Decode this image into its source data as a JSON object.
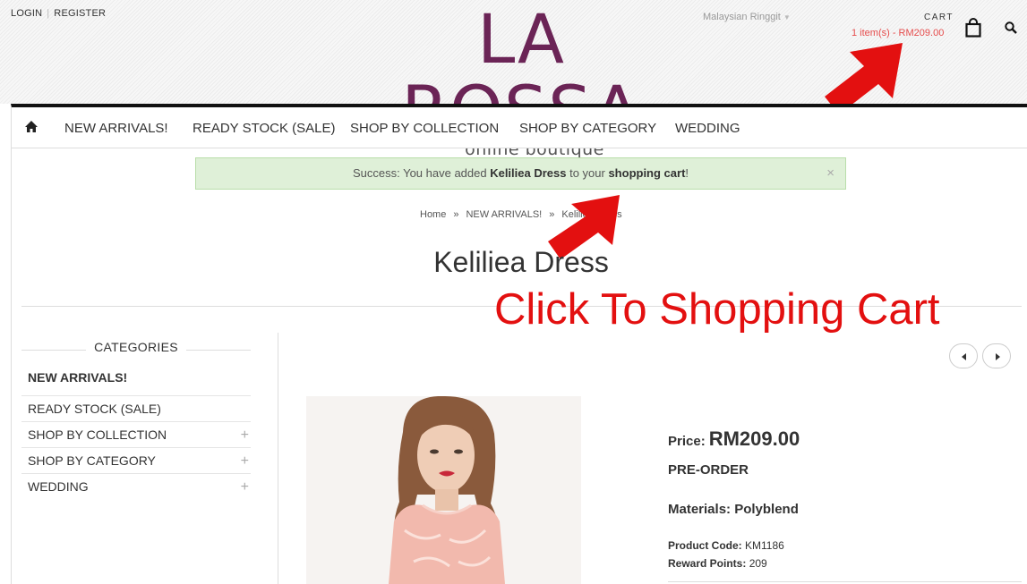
{
  "header": {
    "login_label": "LOGIN",
    "register_label": "REGISTER",
    "logo_main": "LA ROSSA",
    "logo_sub": "online boutique",
    "currency": "Malaysian Ringgit",
    "cart_label": "CART",
    "cart_summary": "1 item(s) - RM209.00"
  },
  "nav": {
    "items": [
      {
        "label": "NEW ARRIVALS!"
      },
      {
        "label": "READY STOCK (SALE)"
      },
      {
        "label": "SHOP BY COLLECTION"
      },
      {
        "label": "SHOP BY CATEGORY"
      },
      {
        "label": "WEDDING"
      }
    ]
  },
  "alert": {
    "prefix": "Success: You have added ",
    "product": "Keliliea Dress",
    "middle": " to your ",
    "cart_link": "shopping cart",
    "suffix": "!",
    "close": "×"
  },
  "breadcrumb": {
    "items": [
      "Home",
      "NEW ARRIVALS!",
      "Keliliea Dress"
    ],
    "separator": "»"
  },
  "product": {
    "title": "Keliliea Dress",
    "price_label": "Price:",
    "price_value": "RM209.00",
    "stock_status": "PRE-ORDER",
    "materials": "Materials: Polyblend",
    "product_code_label": "Product Code:",
    "product_code": "KM1186",
    "reward_points_label": "Reward Points:",
    "reward_points": "209"
  },
  "annotation": {
    "text": "Click To Shopping Cart",
    "color": "#e31010"
  },
  "sidebar": {
    "heading": "CATEGORIES",
    "items": [
      {
        "label": "NEW ARRIVALS!",
        "active": true,
        "expandable": false
      },
      {
        "label": "READY STOCK (SALE)",
        "active": false,
        "expandable": false
      },
      {
        "label": "SHOP BY COLLECTION",
        "active": false,
        "expandable": true
      },
      {
        "label": "SHOP BY CATEGORY",
        "active": false,
        "expandable": true
      },
      {
        "label": "WEDDING",
        "active": false,
        "expandable": true
      }
    ],
    "expand_symbol": "+"
  },
  "icons": {
    "home": "home-icon",
    "bag": "shopping-bag-icon",
    "search": "search-icon",
    "prev": "caret-left-icon",
    "next": "caret-right-icon"
  },
  "colors": {
    "brand": "#6b2456",
    "cart_summary": "#e64c4c",
    "alert_bg": "#dff0d8"
  }
}
